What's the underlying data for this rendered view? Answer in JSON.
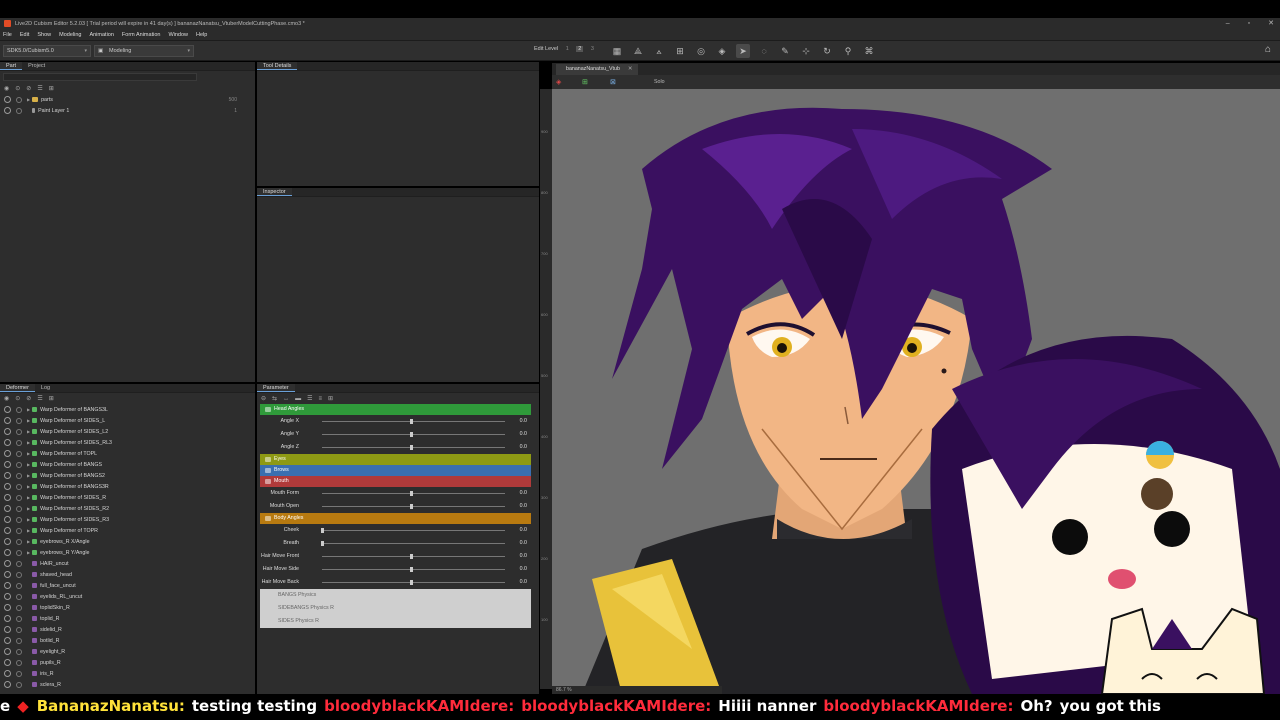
{
  "titlebar": {
    "title": "Live2D Cubism Editor 5.2.03   [ Trial period will expire in 41 day(s) ]   bananazNanatsu_VtuberModelCuttingPhase.cmo3 *"
  },
  "menu": [
    "File",
    "Edit",
    "Show",
    "Modeling",
    "Animation",
    "Form Animation",
    "Window",
    "Help"
  ],
  "toolbar": {
    "sdk": "SDK5.0/Cubism5.0",
    "mode": "Modeling",
    "edit_level_label": "Edit Level",
    "levels": [
      "1",
      "2",
      "3"
    ]
  },
  "parts_panel": {
    "tabs": [
      "Part",
      "Project"
    ],
    "rows": [
      {
        "label": "parts",
        "num": "500"
      },
      {
        "label": "Paint Layer 1",
        "num": "1"
      }
    ]
  },
  "tool_details": {
    "tab": "Tool Details"
  },
  "inspector": {
    "tab": "Inspector"
  },
  "deformer_panel": {
    "tabs": [
      "Deformer",
      "Log"
    ],
    "rows": [
      "Warp Deformer of BANGS3L",
      "Warp Deformer of SIDES_L",
      "Warp Deformer of SIDES_L2",
      "Warp Deformer of SIDES_RL3",
      "Warp Deformer of TOPL",
      "Warp Deformer of BANGS",
      "Warp Deformer of BANGS2",
      "Warp Deformer of BANGS3R",
      "Warp Deformer of SIDES_R",
      "Warp Deformer of SIDES_R2",
      "Warp Deformer of SIDES_R3",
      "Warp Deformer of TOPR",
      "eyebrows_R X/Angle",
      "eyebrows_R Y/Angle",
      "HAIR_uncut",
      "shaved_head",
      "full_face_uncut",
      "eyelids_RL_uncut",
      "toplidSkin_R",
      "toplid_R",
      "sidelid_R",
      "botlid_R",
      "eyelight_R",
      "pupils_R",
      "iris_R",
      "sclera_R"
    ]
  },
  "parameter_panel": {
    "tab": "Parameter",
    "groups": [
      {
        "label": "Head Angles",
        "color": "#2f9a3a",
        "params": [
          {
            "name": "Angle X",
            "value": "0.0",
            "pos": 0.5
          },
          {
            "name": "Angle Y",
            "value": "0.0",
            "pos": 0.5
          },
          {
            "name": "Angle Z",
            "value": "0.0",
            "pos": 0.5
          }
        ]
      },
      {
        "label": "Eyes",
        "color": "#8e9a14",
        "params": []
      },
      {
        "label": "Brows",
        "color": "#3a6fb0",
        "params": []
      },
      {
        "label": "Mouth",
        "color": "#b03a3a",
        "params": [
          {
            "name": "Mouth Form",
            "value": "0.0",
            "pos": 0.5
          },
          {
            "name": "Mouth Open",
            "value": "0.0",
            "pos": 0.5
          }
        ]
      },
      {
        "label": "Body Angles",
        "color": "#b87a10",
        "params": [
          {
            "name": "Cheek",
            "value": "0.0",
            "pos": 0.0
          },
          {
            "name": "Breath",
            "value": "0.0",
            "pos": 0.0
          },
          {
            "name": "Hair Move Front",
            "value": "0.0",
            "pos": 0.5
          },
          {
            "name": "Hair Move Side",
            "value": "0.0",
            "pos": 0.5
          },
          {
            "name": "Hair Move Back",
            "value": "0.0",
            "pos": 0.5
          }
        ]
      }
    ],
    "physics": [
      "BANGS Physics",
      "SIDEBANGS Physics R",
      "SIDES Physics R"
    ]
  },
  "canvas": {
    "tab": "bananazNanatsu_Vtub",
    "solo": "Solo",
    "zoom": "86.7 %",
    "ruler": [
      "900",
      "800",
      "700",
      "600",
      "500",
      "400",
      "300",
      "200",
      "100"
    ]
  },
  "chat_ticker": [
    {
      "text": "e",
      "color": "white"
    },
    {
      "text": "BananazNanatsu:",
      "color": "yellow"
    },
    {
      "text": "testing testing",
      "color": "white"
    },
    {
      "text": "bloodyblackKAMIdere:",
      "color": "red"
    },
    {
      "text": "bloodyblackKAMIdere:",
      "color": "red"
    },
    {
      "text": "Hiiii nanner",
      "color": "white"
    },
    {
      "text": "bloodyblackKAMIdere:",
      "color": "red"
    },
    {
      "text": "Oh?",
      "color": "white"
    },
    {
      "text": "you got this",
      "color": "white"
    }
  ],
  "colors": {
    "accent": "#6aa0d8",
    "hair": "#3a1060",
    "skin": "#f2b685",
    "eyes": "#e0b020"
  }
}
